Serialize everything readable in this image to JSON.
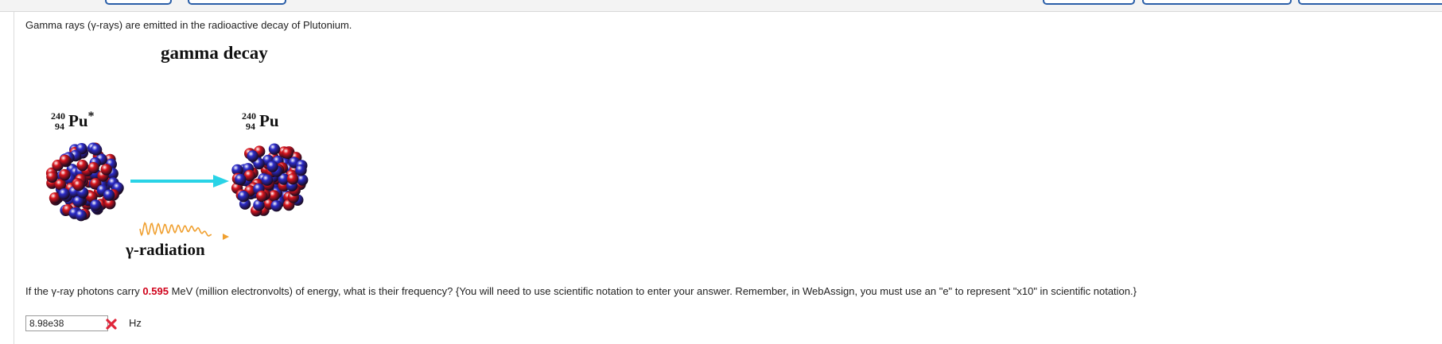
{
  "intro_text": "Gamma rays (γ-rays) are emitted in the radioactive decay of Plutonium.",
  "figure": {
    "title": "gamma decay",
    "parent": {
      "mass": "240",
      "atomic": "94",
      "symbol": "Pu",
      "excited": "*"
    },
    "daughter": {
      "mass": "240",
      "atomic": "94",
      "symbol": "Pu"
    },
    "radiation_label": "γ-radiation",
    "colors": {
      "proton": "#d8141c",
      "neutron": "#2b2bc8",
      "arrow": "#29d3e6",
      "wave": "#f0a030"
    }
  },
  "question": {
    "before": "If the γ-ray photons carry ",
    "value": "0.595",
    "after": " MeV (million electronvolts) of energy, what is their frequency? {You will need to use scientific notation to enter your answer. Remember, in WebAssign, you must use an \"e\" to represent \"x10\" in scientific notation.}"
  },
  "answer": {
    "value": "8.98e38",
    "status": "incorrect",
    "status_icon": "x-icon",
    "unit": "Hz"
  }
}
